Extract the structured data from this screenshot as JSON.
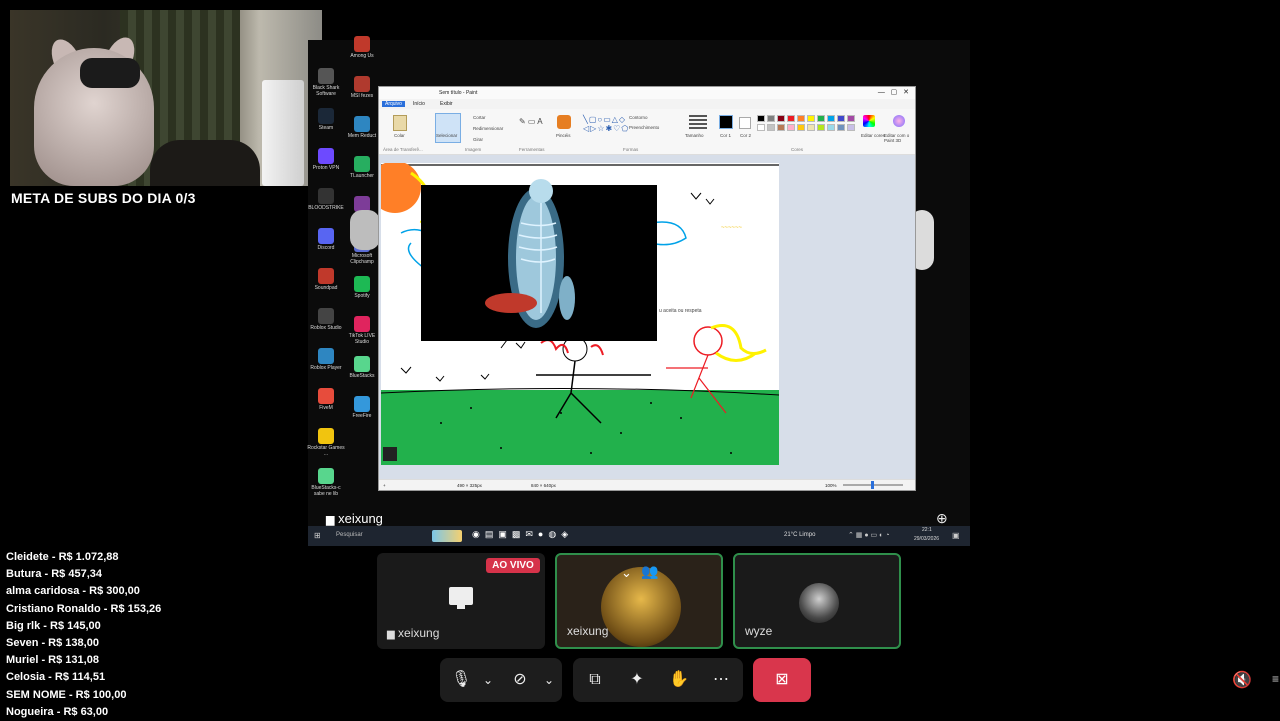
{
  "overlay": {
    "goal_text": "META DE SUBS DO DIA 0/3",
    "donors": [
      "Cleidete - R$ 1.072,88",
      "Butura - R$ 457,34",
      "alma caridosa - R$ 300,00",
      "Cristiano Ronaldo - R$ 153,26",
      "Big rlk - R$ 145,00",
      "Seven - R$ 138,00",
      "Muriel - R$ 131,08",
      "Celosia - R$ 114,51",
      "SEM NOME - R$ 100,00",
      "Nogueira - R$ 63,00"
    ]
  },
  "shared_screen": {
    "presenter_label": "xeixung",
    "desktop_icons": [
      {
        "label": "Among Us",
        "color": "#c0392b"
      },
      {
        "label": "MSI fezes",
        "color": "#b03a2e"
      },
      {
        "label": "Mem Reduct",
        "color": "#2e86c1"
      },
      {
        "label": "TLauncher",
        "color": "#27ae60"
      },
      {
        "label": "CPU-Z",
        "color": "#7d3c98"
      },
      {
        "label": "Microsoft Clipchamp",
        "color": "#5b6cd3"
      },
      {
        "label": "Spotify",
        "color": "#1db954"
      },
      {
        "label": "TikTok LIVE Studio",
        "color": "#e0245e"
      },
      {
        "label": "BlueStacks",
        "color": "#58d68d"
      },
      {
        "label": "FreeFire",
        "color": "#3498db"
      }
    ],
    "desktop_icons_left": [
      {
        "label": "Black Shark Software",
        "color": "#555"
      },
      {
        "label": "Steam",
        "color": "#1b2838"
      },
      {
        "label": "Proton VPN",
        "color": "#6d4aff"
      },
      {
        "label": "BLOODSTRIKE",
        "color": "#333"
      },
      {
        "label": "Discord",
        "color": "#5865f2"
      },
      {
        "label": "Soundpad",
        "color": "#c0392b"
      },
      {
        "label": "Roblox Studio",
        "color": "#444"
      },
      {
        "label": "Roblox Player",
        "color": "#2e86c1"
      },
      {
        "label": "FiveM",
        "color": "#e74c3c"
      },
      {
        "label": "Rockstar Games ...",
        "color": "#f1c40f"
      },
      {
        "label": "BlueStacks-c sabe ne lib",
        "color": "#58d68d"
      }
    ],
    "paint": {
      "title": "Sem título - Paint",
      "menu": [
        "Arquivo",
        "Início",
        "Exibir"
      ],
      "ribbon_groups": [
        "Área de Transferê...",
        "Imagem",
        "Ferramentas",
        "Formas",
        "Cores"
      ],
      "ribbon_labels": [
        "Colar",
        "Selecionar",
        "Cortar",
        "Redimensionar",
        "Girar",
        "Pincéis",
        "Contorno",
        "Preenchimento",
        "Tamanho",
        "Cor 1",
        "Cor 2",
        "Editar cores",
        "Editar com o Paint 3D"
      ],
      "canvas_text": "u aceita ou respeta",
      "canvas_scribble_yellow": "~~~~~~",
      "status_selection": "490 × 325px",
      "status_size": "840 × 640px",
      "zoom": "100%",
      "palette": [
        "#000000",
        "#7f7f7f",
        "#880015",
        "#ed1c24",
        "#ff7f27",
        "#fff200",
        "#22b14c",
        "#00a2e8",
        "#3f48cc",
        "#a349a4",
        "#ffffff",
        "#c3c3c3",
        "#b97a57",
        "#ffaec9",
        "#ffc90e",
        "#efe4b0",
        "#b5e61d",
        "#99d9ea",
        "#7092be",
        "#c8bfe7"
      ]
    },
    "taskbar": {
      "search_placeholder": "Pesquisar",
      "weather": "21°C  Limpo",
      "time": "22:1",
      "date": "29/03/2026"
    }
  },
  "participants": [
    {
      "name": "xeixung",
      "type": "screen"
    },
    {
      "name": "xeixung",
      "type": "camera"
    },
    {
      "name": "wyze",
      "type": "avatar"
    }
  ],
  "live_badge": "AO VIVO",
  "controls": {
    "mic": "microphone",
    "camera": "camera-off",
    "share": "share-screen",
    "effects": "effects",
    "reactions": "reactions",
    "more": "more",
    "leave": "leave"
  },
  "colors": {
    "live_red": "#d6334a",
    "leave_red": "#d9364c",
    "active_border": "#2f8f4b",
    "grass": "#22b14c"
  }
}
